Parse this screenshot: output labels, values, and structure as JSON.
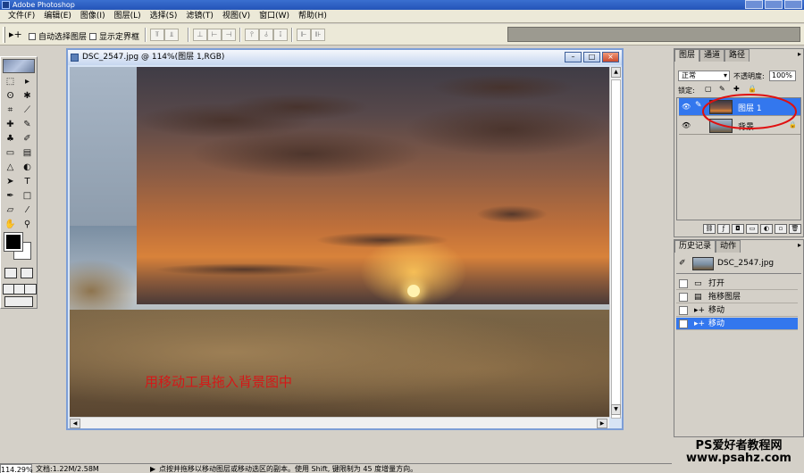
{
  "app": {
    "title": "Adobe Photoshop"
  },
  "menu": [
    "文件(F)",
    "编辑(E)",
    "图像(I)",
    "图层(L)",
    "选择(S)",
    "滤镜(T)",
    "视图(V)",
    "窗口(W)",
    "帮助(H)"
  ],
  "options": {
    "auto_select": "自动选择图层",
    "show_bounds": "显示定界框"
  },
  "document": {
    "title": "DSC_2547.jpg @ 114%(图层 1,RGB)",
    "annotation": "用移动工具拖入背景图中"
  },
  "layers_panel": {
    "tabs": [
      "图层",
      "通道",
      "路径"
    ],
    "blend_mode": "正常",
    "opacity_label": "不透明度:",
    "opacity_value": "100%",
    "lock_label": "锁定:",
    "layers": [
      {
        "name": "图层 1",
        "selected": true
      },
      {
        "name": "背景",
        "selected": false
      }
    ]
  },
  "history_panel": {
    "tabs": [
      "历史记录",
      "动作"
    ],
    "snapshot": "DSC_2547.jpg",
    "items": [
      {
        "label": "打开",
        "selected": false
      },
      {
        "label": "拖移图层",
        "selected": false
      },
      {
        "label": "移动",
        "selected": false
      },
      {
        "label": "移动",
        "selected": true
      }
    ]
  },
  "status": {
    "zoom": "114.29%",
    "doc": "文档:1.22M/2.58M",
    "hint": "点按并拖移以移动图层或移动选区的副本。使用 Shift, 键限制为 45 度增量方向。"
  },
  "watermark": {
    "line1": "PS爱好者教程网",
    "line2": "www.psahz.com"
  },
  "colors": {
    "foreground": "#000000",
    "background": "#ffffff",
    "selection": "#3377ee",
    "annotation_circle": "#e01010"
  }
}
